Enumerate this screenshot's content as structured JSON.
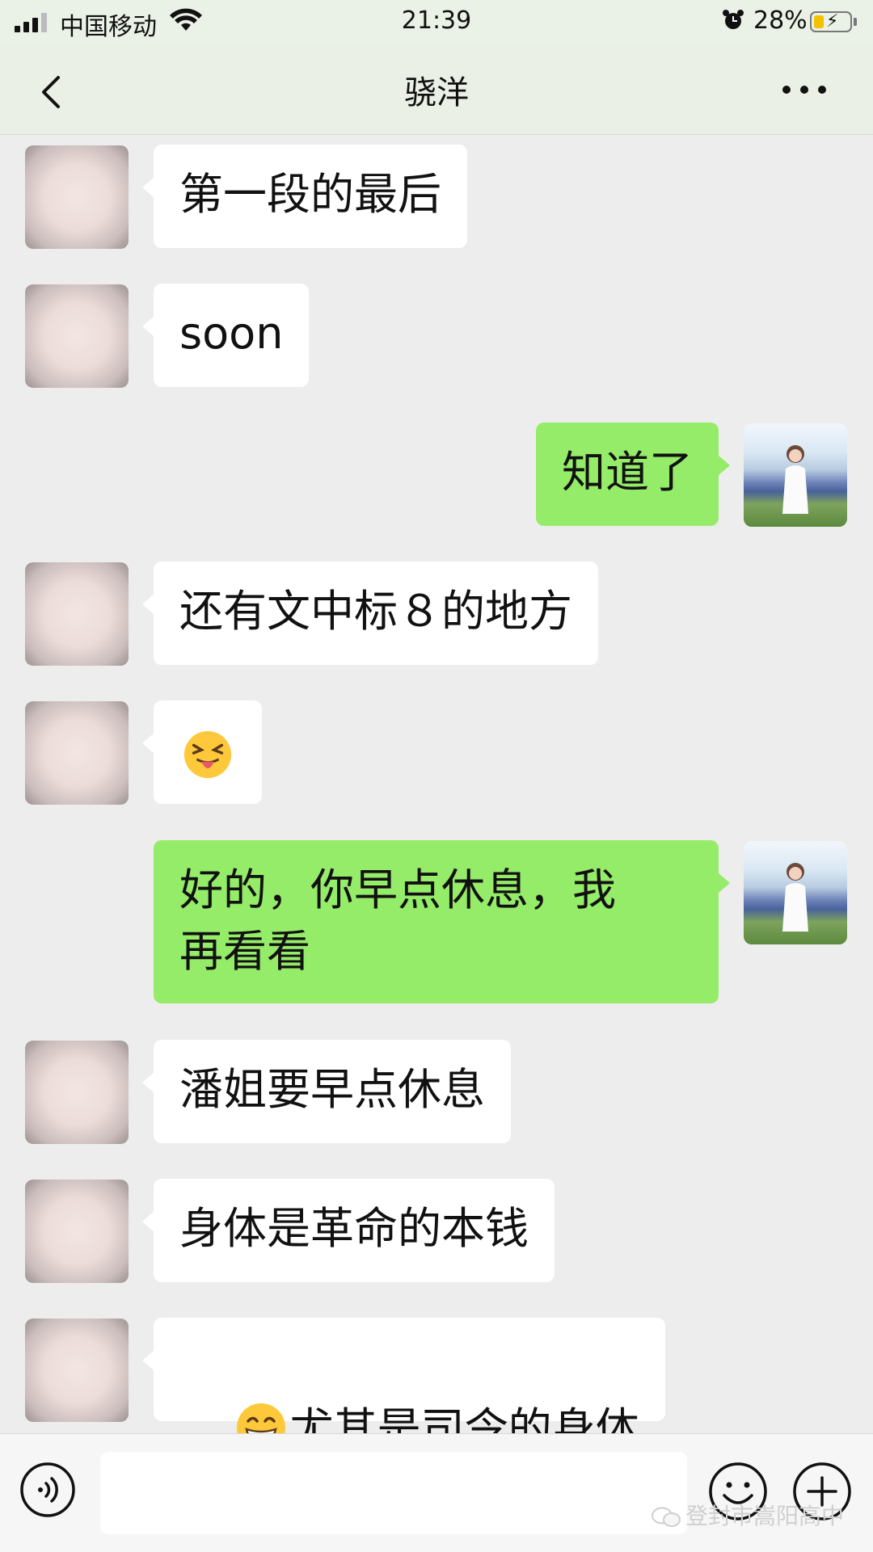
{
  "status_bar": {
    "carrier": "中国移动",
    "time": "21:39",
    "battery_percent": "28%",
    "battery_level": 0.28
  },
  "nav": {
    "title": "骁洋",
    "back_icon": "chevron-left-icon",
    "more_icon": "more-dots-icon"
  },
  "messages": [
    {
      "side": "left",
      "text": "第一段的最后"
    },
    {
      "side": "left",
      "text": "soon"
    },
    {
      "side": "right",
      "text": "知道了"
    },
    {
      "side": "left",
      "text": "还有文中标８的地方"
    },
    {
      "side": "left",
      "text": "",
      "emoji": "squinting-tongue-face"
    },
    {
      "side": "right",
      "text": "好的，你早点休息，我\n再看看"
    },
    {
      "side": "left",
      "text": "潘姐要早点休息"
    },
    {
      "side": "left",
      "text": "身体是革命的本钱"
    },
    {
      "side": "left",
      "text": "尤其是司令的身体",
      "emoji": "grinning-face"
    }
  ],
  "input_bar": {
    "value": "",
    "voice_icon": "voice-icon",
    "emoji_icon": "emoji-icon",
    "plus_icon": "plus-icon"
  },
  "watermark": "登封市嵩阳高中",
  "colors": {
    "bubble_self": "#95ec69",
    "bubble_other": "#ffffff",
    "background": "#ededed"
  }
}
